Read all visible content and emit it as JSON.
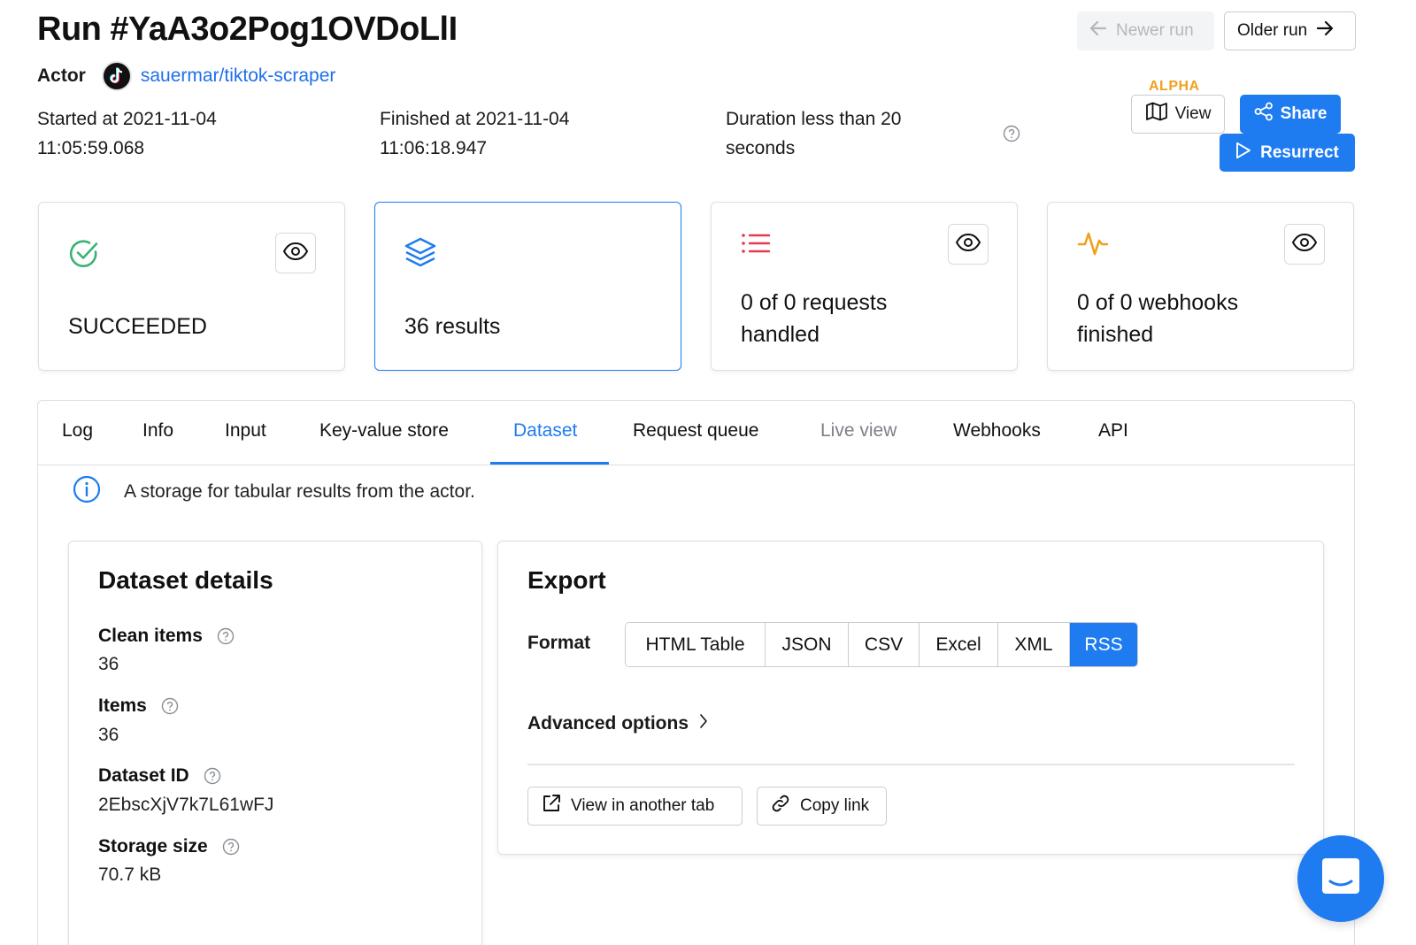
{
  "run": {
    "title": "Run #YaA3o2Pog1OVDoLlI",
    "actor_label": "Actor",
    "actor_name": "sauermar/tiktok-scraper",
    "started": "Started at 2021-11-04",
    "started_time": "11:05:59.068",
    "finished": "Finished at 2021-11-04",
    "finished_time": "11:06:18.947",
    "duration_line1": "Duration less than 20",
    "duration_line2": "seconds"
  },
  "nav": {
    "newer_label": "Newer run",
    "older_label": "Older run"
  },
  "actions": {
    "alpha_badge": "ALPHA",
    "view_label": "View",
    "share_label": "Share",
    "resurrect_label": "Resurrect"
  },
  "cards": {
    "status": "SUCCEEDED",
    "results": "36 results",
    "requests_line1": "0 of 0 requests",
    "requests_line2": "handled",
    "webhooks_line1": "0 of 0 webhooks",
    "webhooks_line2": "finished"
  },
  "tabs": [
    {
      "label": "Log"
    },
    {
      "label": "Info"
    },
    {
      "label": "Input"
    },
    {
      "label": "Key-value store"
    },
    {
      "label": "Dataset"
    },
    {
      "label": "Request queue"
    },
    {
      "label": "Live view"
    },
    {
      "label": "Webhooks"
    },
    {
      "label": "API"
    }
  ],
  "active_tab": "Dataset",
  "info_text": "A storage for tabular results from the actor.",
  "dataset_details": {
    "title": "Dataset details",
    "clean_items_label": "Clean items",
    "clean_items_value": "36",
    "items_label": "Items",
    "items_value": "36",
    "dataset_id_label": "Dataset ID",
    "dataset_id_value": "2EbscXjV7k7L61wFJ",
    "storage_size_label": "Storage size",
    "storage_size_value": "70.7 kB"
  },
  "export": {
    "title": "Export",
    "format_label": "Format",
    "formats": [
      "HTML Table",
      "JSON",
      "CSV",
      "Excel",
      "XML",
      "RSS"
    ],
    "selected_format": "RSS",
    "advanced_label": "Advanced options",
    "view_tab_label": "View in another tab",
    "copy_link_label": "Copy link"
  },
  "colors": {
    "accent": "#1f7cf0",
    "success": "#3bb273",
    "danger": "#e8384f",
    "warning": "#f0a020"
  }
}
